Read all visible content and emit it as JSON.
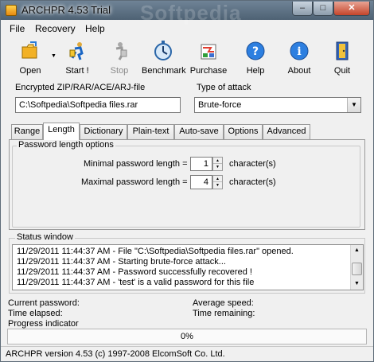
{
  "window": {
    "title": "ARCHPR 4.53 Trial",
    "watermark": "Softpedia",
    "controls": {
      "minimize": "–",
      "maximize": "□",
      "close": "✕"
    }
  },
  "menu": [
    "File",
    "Recovery",
    "Help"
  ],
  "toolbar": [
    {
      "label": "Open",
      "icon": "open-folder-icon",
      "enabled": true
    },
    {
      "label": "Start !",
      "icon": "start-runner-icon",
      "enabled": true
    },
    {
      "label": "Stop",
      "icon": "stop-runner-icon",
      "enabled": false
    },
    {
      "label": "Benchmark",
      "icon": "stopwatch-icon",
      "enabled": true
    },
    {
      "label": "Purchase",
      "icon": "purchase-icon",
      "enabled": true
    },
    {
      "label": "Help",
      "icon": "help-icon",
      "enabled": true
    },
    {
      "label": "About",
      "icon": "about-icon",
      "enabled": true
    },
    {
      "label": "Quit",
      "icon": "quit-door-icon",
      "enabled": true
    }
  ],
  "encrypted_file": {
    "label": "Encrypted ZIP/RAR/ACE/ARJ-file",
    "value": "C:\\Softpedia\\Softpedia files.rar"
  },
  "attack": {
    "label": "Type of attack",
    "selected": "Brute-force"
  },
  "tabs": [
    "Range",
    "Length",
    "Dictionary",
    "Plain-text",
    "Auto-save",
    "Options",
    "Advanced"
  ],
  "active_tab": "Length",
  "length_panel": {
    "group_title": "Password length options",
    "min_label": "Minimal password length =",
    "min_value": "1",
    "max_label": "Maximal password length =",
    "max_value": "4",
    "unit": "character(s)"
  },
  "status_window": {
    "title": "Status window",
    "lines": [
      "11/29/2011 11:44:37 AM - File \"C:\\Softpedia\\Softpedia files.rar\" opened.",
      "11/29/2011 11:44:37 AM - Starting brute-force attack...",
      "11/29/2011 11:44:37 AM - Password successfully recovered !",
      "11/29/2011 11:44:37 AM - 'test' is a valid password for this file"
    ]
  },
  "info": {
    "current_password": "Current password:",
    "time_elapsed": "Time elapsed:",
    "progress_indicator": "Progress indicator",
    "average_speed": "Average speed:",
    "time_remaining": "Time remaining:"
  },
  "progress": {
    "percent": 0,
    "text": "0%"
  },
  "statusbar": "ARCHPR version 4.53 (c) 1997-2008 ElcomSoft Co. Ltd."
}
